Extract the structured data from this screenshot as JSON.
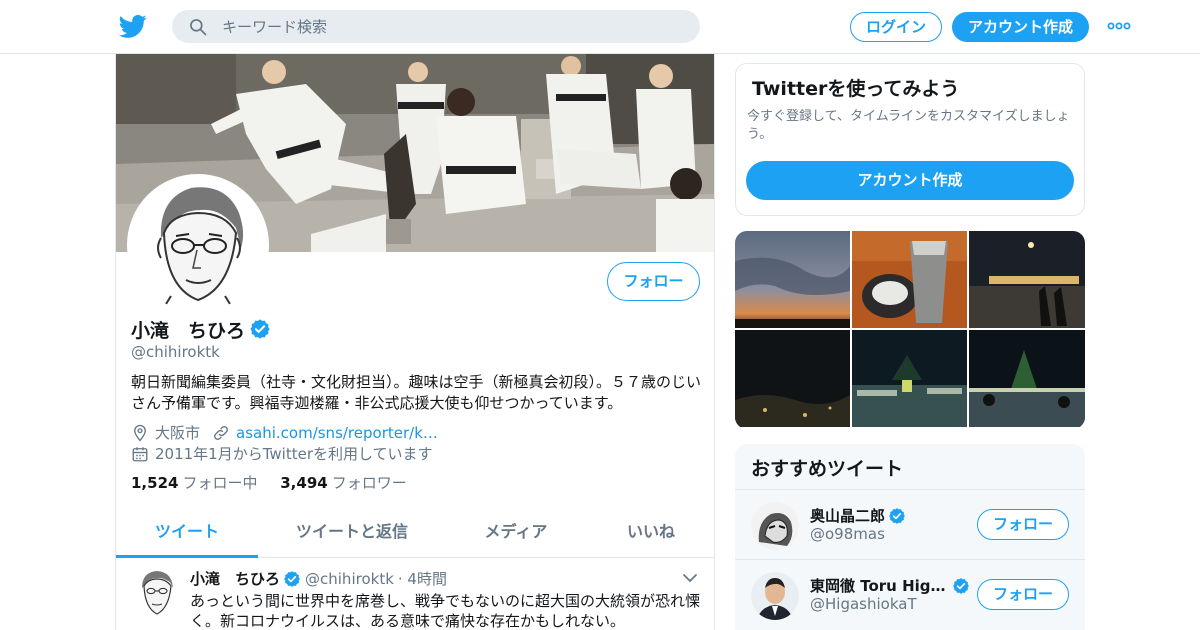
{
  "header": {
    "search_placeholder": "キーワード検索",
    "login_label": "ログイン",
    "signup_label": "アカウント作成"
  },
  "profile": {
    "name": "小滝　ちひろ",
    "handle": "@chihiroktk",
    "bio": "朝日新聞編集委員（社寺・文化財担当）。趣味は空手（新極真会初段）。５７歳のじいさん予備軍です。興福寺迦楼羅・非公式応援大使も仰せつかっています。",
    "location": "大阪市",
    "link": "asahi.com/sns/reporter/k…",
    "joined": "2011年1月からTwitterを利用しています",
    "following_count": "1,524",
    "following_label": "フォロー中",
    "followers_count": "3,494",
    "followers_label": "フォロワー",
    "follow_label": "フォロー"
  },
  "tabs": [
    {
      "label": "ツイート"
    },
    {
      "label": "ツイートと返信"
    },
    {
      "label": "メディア"
    },
    {
      "label": "いいね"
    }
  ],
  "tweet": {
    "name": "小滝　ちひろ",
    "handle": "@chihiroktk",
    "time": "· 4時間",
    "text": "あっという間に世界中を席巻し、戦争でもないのに超大国の大統領が恐れ慄く。新コロナウイルスは、ある意味で痛快な存在かもしれない。"
  },
  "signup_card": {
    "title": "Twitterを使ってみよう",
    "description": "今すぐ登録して、タイムラインをカスタマイズしましょう。",
    "button": "アカウント作成"
  },
  "recommended": {
    "title": "おすすめツイート",
    "users": [
      {
        "name": "奥山晶二郎",
        "handle": "@o98mas",
        "follow": "フォロー"
      },
      {
        "name": "東岡徹 Toru Higa…",
        "handle": "@HigashiokaT",
        "follow": "フォロー"
      }
    ]
  },
  "colors": {
    "accent": "#1da1f2",
    "text": "#14171a",
    "muted": "#657786",
    "border": "#e1e8ed"
  },
  "icons": [
    "twitter-bird-icon",
    "search-icon",
    "more-dots-icon",
    "verified-badge-icon",
    "location-pin-icon",
    "link-icon",
    "calendar-icon",
    "chevron-down-icon"
  ]
}
